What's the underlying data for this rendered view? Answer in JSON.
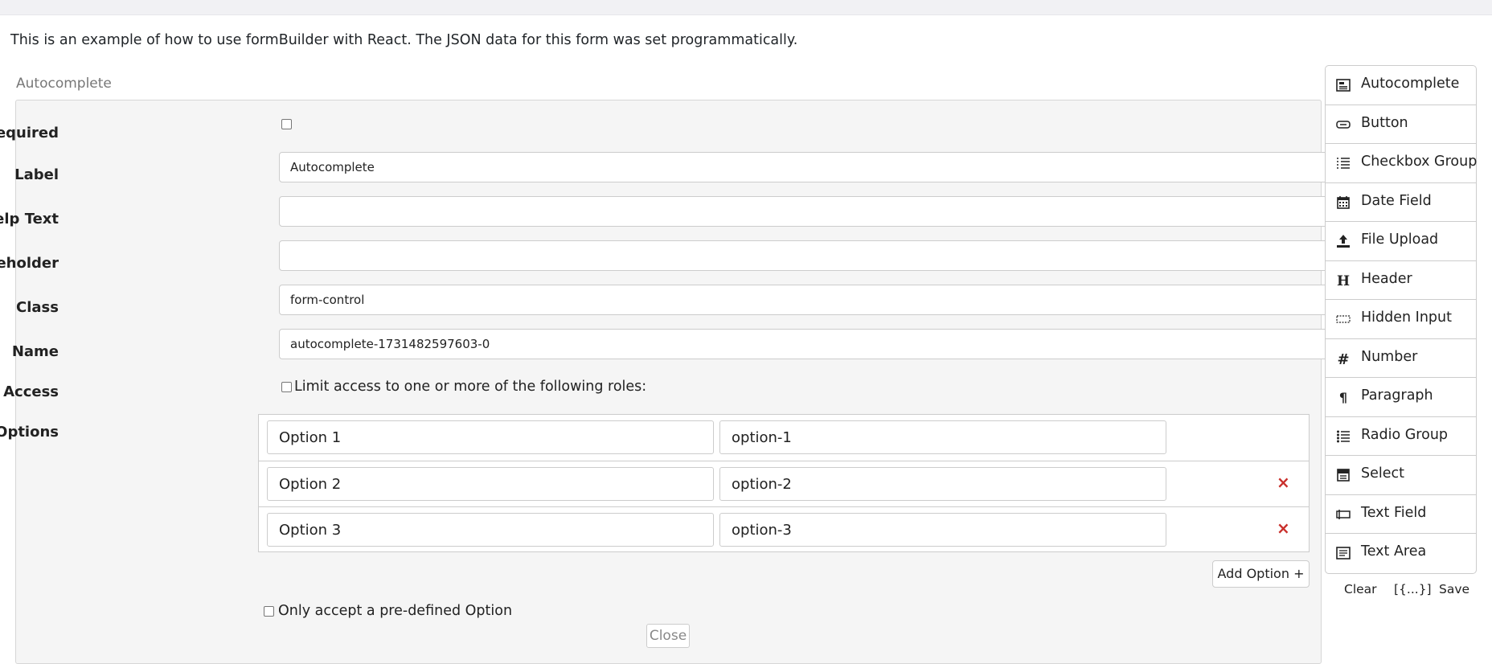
{
  "intro_text": "This is an example of how to use formBuilder with React. The JSON data for this form was set programmatically.",
  "field_title": "Autocomplete",
  "form": {
    "required_label": "Required",
    "label_label": "Label",
    "label_value": "Autocomplete",
    "help_label": "Help Text",
    "help_value": "",
    "placeholder_label": "Placeholder",
    "placeholder_value": "",
    "class_label": "Class",
    "class_value": "form-control",
    "name_label": "Name",
    "name_value": "autocomplete-1731482597603-0",
    "access_label": "Access",
    "access_text": "Limit access to one or more of the following roles:",
    "options_label": "Options",
    "options": [
      {
        "label": "Option 1",
        "value": "option-1"
      },
      {
        "label": "Option 2",
        "value": "option-2"
      },
      {
        "label": "Option 3",
        "value": "option-3"
      }
    ],
    "remove_symbol": "×",
    "add_option": "Add Option +",
    "predefined_text": "Only accept a pre-defined Option",
    "close": "Close"
  },
  "controls": [
    {
      "label": "Autocomplete",
      "icon": "autocomplete-icon"
    },
    {
      "label": "Button",
      "icon": "button-icon"
    },
    {
      "label": "Checkbox Group",
      "icon": "checkbox-group-icon"
    },
    {
      "label": "Date Field",
      "icon": "calendar-icon"
    },
    {
      "label": "File Upload",
      "icon": "upload-icon"
    },
    {
      "label": "Header",
      "icon": "header-icon"
    },
    {
      "label": "Hidden Input",
      "icon": "hidden-input-icon"
    },
    {
      "label": "Number",
      "icon": "number-icon"
    },
    {
      "label": "Paragraph",
      "icon": "paragraph-icon"
    },
    {
      "label": "Radio Group",
      "icon": "radio-group-icon"
    },
    {
      "label": "Select",
      "icon": "select-icon"
    },
    {
      "label": "Text Field",
      "icon": "text-field-icon"
    },
    {
      "label": "Text Area",
      "icon": "text-area-icon"
    }
  ],
  "actions": {
    "clear": "Clear",
    "data": "[{...}]",
    "save": "Save"
  },
  "colors": {
    "remove": "#c9302c",
    "panel_bg": "#f5f5f5",
    "border": "#cccccc"
  }
}
